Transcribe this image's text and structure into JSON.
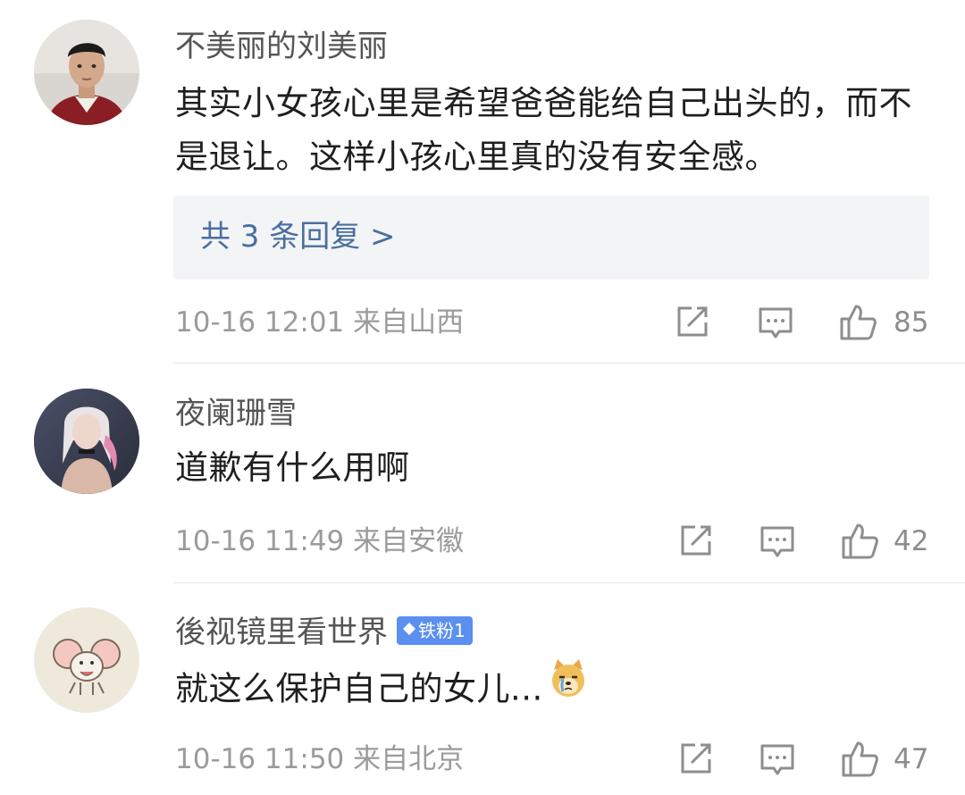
{
  "comments": [
    {
      "username": "不美丽的刘美丽",
      "text": "其实小女孩心里是希望爸爸能给自己出头的，而不是退让。这样小孩心里真的没有安全感。",
      "replies_label": "共 3 条回复 >",
      "timestamp": "10-16 12:01",
      "location": "来自山西",
      "likes": "85",
      "avatar_icon": "avatar-young-man-photo"
    },
    {
      "username": "夜阑珊雪",
      "text": "道歉有什么用啊",
      "timestamp": "10-16 11:49",
      "location": "来自安徽",
      "likes": "42",
      "avatar_icon": "avatar-anime-character"
    },
    {
      "username": "後视镜里看世界",
      "badge": "铁粉1",
      "text": "就这么保护自己的女儿...",
      "emoji": "crying-doge-emoji",
      "timestamp": "10-16 11:50",
      "location": "来自北京",
      "likes": "47",
      "avatar_icon": "avatar-cartoon-mouse"
    }
  ],
  "icons": {
    "share": "share-icon",
    "comment": "comment-icon",
    "like": "thumbs-up-icon"
  },
  "colors": {
    "reply_link": "#4a6fa0",
    "badge": "#5b8ff0",
    "meta_text": "#9b9b9b"
  }
}
